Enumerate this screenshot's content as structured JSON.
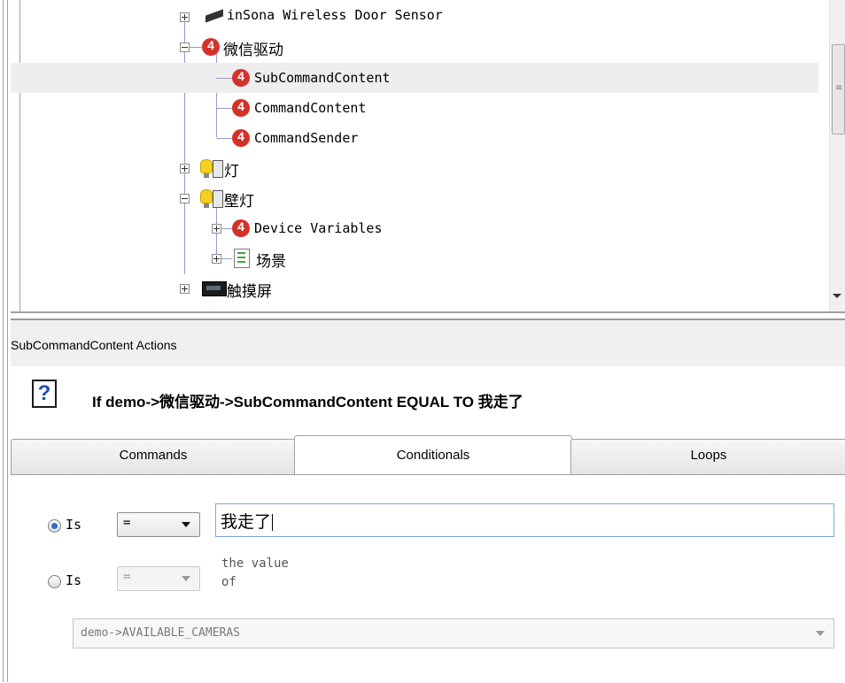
{
  "tree": {
    "items": [
      {
        "label": "inSona Wireless Door Sensor",
        "icon": "door-sensor-icon"
      },
      {
        "label": "微信驱动",
        "icon": "driver-icon"
      },
      {
        "label": "SubCommandContent",
        "icon": "variable-icon"
      },
      {
        "label": "CommandContent",
        "icon": "variable-icon"
      },
      {
        "label": "CommandSender",
        "icon": "variable-icon"
      },
      {
        "label": "灯",
        "icon": "light-icon"
      },
      {
        "label": "壁灯",
        "icon": "light-icon"
      },
      {
        "label": "Device Variables",
        "icon": "variable-icon"
      },
      {
        "label": "场景",
        "icon": "scene-icon"
      },
      {
        "label": "触摸屏",
        "icon": "touchscreen-icon"
      }
    ]
  },
  "actions": {
    "title": "SubCommandContent Actions",
    "summary": "If demo->微信驱动->SubCommandContent  EQUAL  TO 我走了",
    "help_icon": "?"
  },
  "tabs": [
    {
      "label": "Commands",
      "active": false
    },
    {
      "label": "Conditionals",
      "active": true
    },
    {
      "label": "Loops",
      "active": false
    }
  ],
  "conditional": {
    "row1": {
      "radio_label": "Is",
      "operator": "=",
      "value": "我走了",
      "selected": true
    },
    "row2": {
      "radio_label": "Is",
      "operator": "=",
      "hint": "the value\nof",
      "selected": false
    },
    "variable": "demo->AVAILABLE_CAMERAS"
  },
  "colors": {
    "driver_icon": "#d43228",
    "selection_bg": "#eeeeef",
    "tree_lines": "#9999d0"
  }
}
